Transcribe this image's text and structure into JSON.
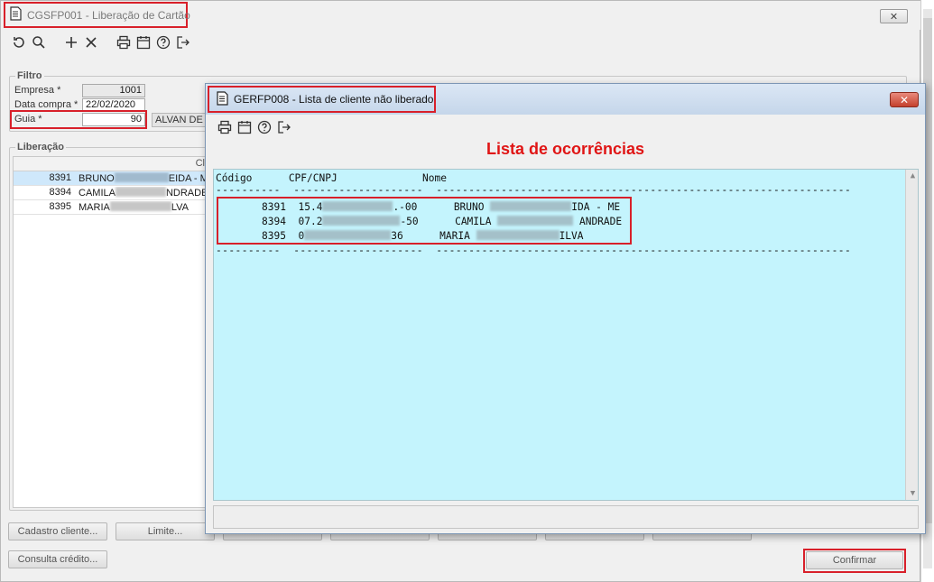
{
  "main_window": {
    "title": "CGSFP001 - Liberação de Cartão",
    "close_label": "✕"
  },
  "toolbar": {
    "icons": [
      "refresh-icon",
      "search-icon",
      "add-icon",
      "delete-icon",
      "print-icon",
      "calendar-icon",
      "help-icon",
      "exit-icon"
    ]
  },
  "filtro": {
    "label": "Filtro",
    "empresa_label": "Empresa *",
    "empresa_value": "1001",
    "data_compra_label": "Data compra *",
    "data_compra_value": "22/02/2020",
    "guia_label": "Guia *",
    "guia_value": "90",
    "alvan_text": "ALVAN  DE"
  },
  "liberacao": {
    "label": "Liberação",
    "column_header": "Cl",
    "rows": [
      {
        "code": "8391",
        "name_start": "BRUNO",
        "name_end": "EIDA - M"
      },
      {
        "code": "8394",
        "name_start": "CAMILA",
        "name_end": "NDRADE"
      },
      {
        "code": "8395",
        "name_start": "MARIA",
        "name_end": "LVA"
      }
    ]
  },
  "bottom_buttons": {
    "cadastro_cliente": "Cadastro cliente...",
    "limite": "Limite...",
    "consulta_credito": "Consulta crédito...",
    "confirmar": "Confirmar"
  },
  "dialog": {
    "title": "GERFP008 - Lista de cliente não liberado",
    "close_label": "✕",
    "heading": "Lista de ocorrências",
    "report_header": "Código      CPF/CNPJ              Nome",
    "separator": "----------  --------------------  ----------------------------------------------------------------",
    "records": [
      {
        "code": "8391",
        "cpf_start": "15.4",
        "cpf_end": ".-00",
        "name_start": "BRUNO ",
        "name_end": "IDA - ME"
      },
      {
        "code": "8394",
        "cpf_start": "07.2",
        "cpf_end": "-50",
        "name_start": "CAMILA ",
        "name_end": " ANDRADE"
      },
      {
        "code": "8395",
        "cpf_start": "0",
        "cpf_end": "36",
        "name_start": "MARIA ",
        "name_end": "ILVA"
      }
    ]
  },
  "colors": {
    "highlight": "#d8202a",
    "report_bg": "#c4f4fd",
    "heading": "#e01515",
    "selected_row": "#cfe8fb"
  }
}
